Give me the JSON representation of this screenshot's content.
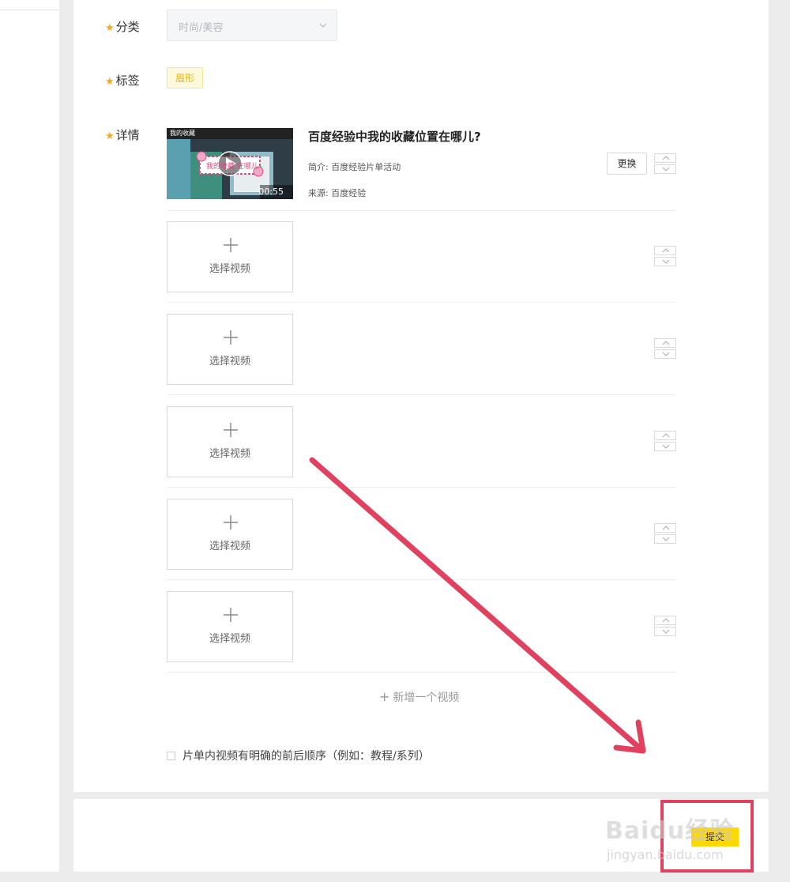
{
  "form": {
    "category_label": "分类",
    "category_value": "时尚/美容",
    "tags_label": "标签",
    "tag": "眉形",
    "detail_label": "详情",
    "required_mark": "★"
  },
  "video": {
    "title": "百度经验中我的收藏位置在哪儿?",
    "desc": "简介: 百度经验片单活动",
    "source": "来源: 百度经验",
    "duration": "00:55",
    "replace_label": "更换",
    "thumb_top_text": "我的收藏",
    "thumb_banner": "我的收藏 在哪儿"
  },
  "slots": [
    {
      "label": "选择视频"
    },
    {
      "label": "选择视频"
    },
    {
      "label": "选择视频"
    },
    {
      "label": "选择视频"
    },
    {
      "label": "选择视频"
    }
  ],
  "add_video_label": "新增一个视频",
  "add_video_icon": "+",
  "order_checkbox_label": "片单内视频有明确的前后顺序（例如：教程/系列）",
  "submit_label": "提交",
  "watermark": {
    "brand": "Baidu经验",
    "url": "jingyan.baidu.com"
  },
  "colors": {
    "accent": "#ffd800",
    "star": "#f5a623",
    "annotation": "#e0415f"
  }
}
